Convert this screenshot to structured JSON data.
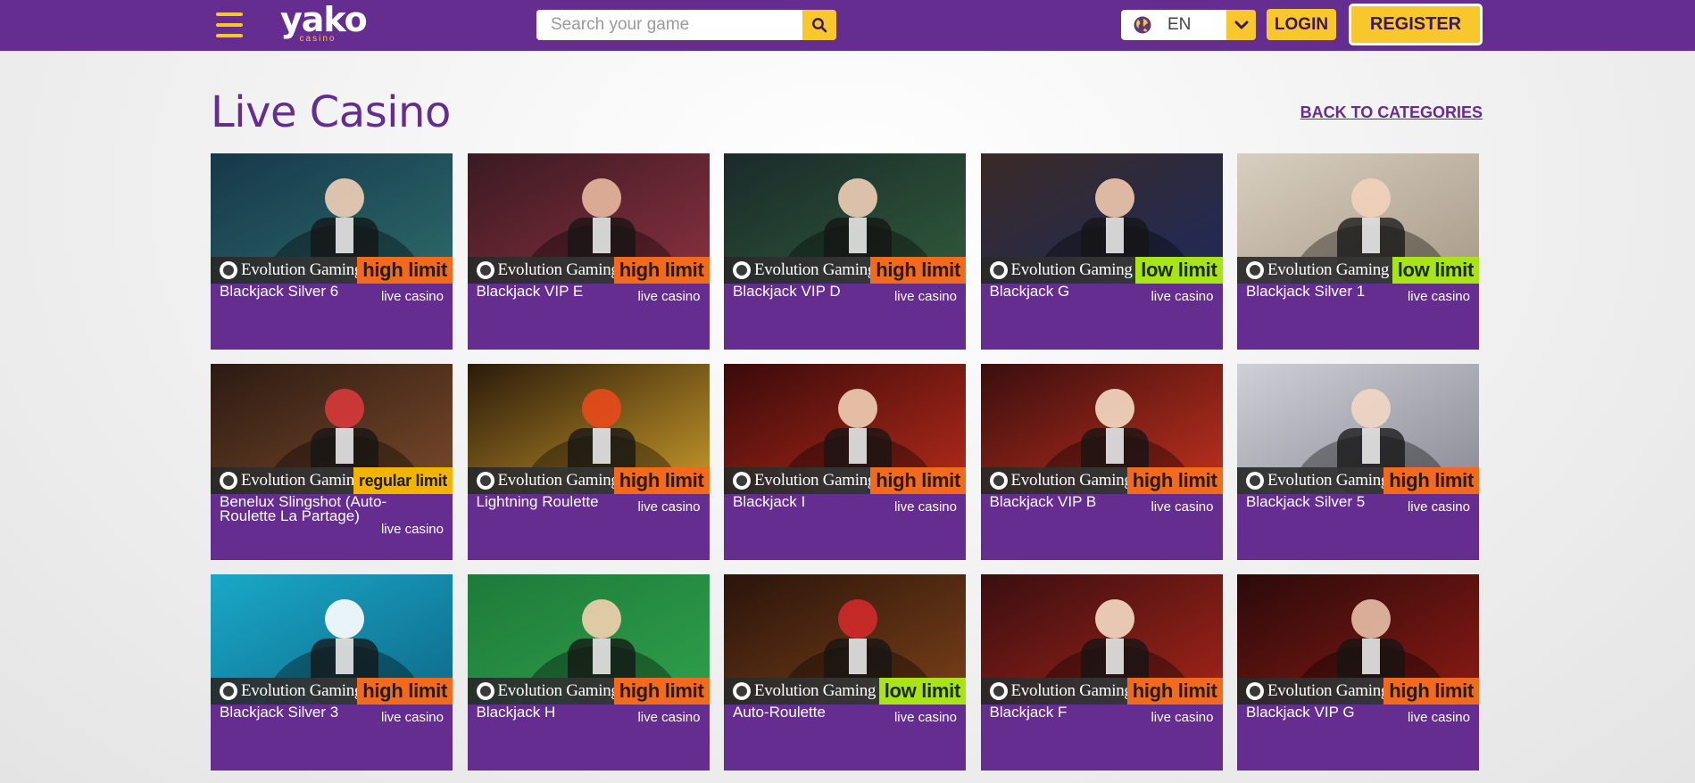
{
  "header": {
    "logo": {
      "main": "yako",
      "sub": "casino"
    },
    "search": {
      "placeholder": "Search your game"
    },
    "language": {
      "code": "EN"
    },
    "login_label": "LOGIN",
    "register_label": "REGISTER",
    "colors": {
      "brand": "#662d91",
      "accent": "#f7c72c"
    }
  },
  "page": {
    "title": "Live Casino",
    "back_link": "BACK TO CATEGORIES"
  },
  "games": [
    {
      "name": "Blackjack Silver 6",
      "category": "live casino",
      "provider": "Evolution Gaming",
      "limit": "high limit",
      "limit_type": "high"
    },
    {
      "name": "Blackjack VIP E",
      "category": "live casino",
      "provider": "Evolution Gaming",
      "limit": "high limit",
      "limit_type": "high"
    },
    {
      "name": "Blackjack VIP D",
      "category": "live casino",
      "provider": "Evolution Gaming",
      "limit": "high limit",
      "limit_type": "high"
    },
    {
      "name": "Blackjack G",
      "category": "live casino",
      "provider": "Evolution Gaming",
      "limit": "low limit",
      "limit_type": "low"
    },
    {
      "name": "Blackjack Silver 1",
      "category": "live casino",
      "provider": "Evolution Gaming",
      "limit": "low limit",
      "limit_type": "low"
    },
    {
      "name": "Benelux Slingshot (Auto-Roulette La Partage)",
      "category": "live casino",
      "provider": "Evolution Gaming",
      "limit": "regular limit",
      "limit_type": "regular"
    },
    {
      "name": "Lightning Roulette",
      "category": "live casino",
      "provider": "Evolution Gaming",
      "limit": "high limit",
      "limit_type": "high"
    },
    {
      "name": "Blackjack I",
      "category": "live casino",
      "provider": "Evolution Gaming",
      "limit": "high limit",
      "limit_type": "high"
    },
    {
      "name": "Blackjack VIP B",
      "category": "live casino",
      "provider": "Evolution Gaming",
      "limit": "high limit",
      "limit_type": "high"
    },
    {
      "name": "Blackjack Silver 5",
      "category": "live casino",
      "provider": "Evolution Gaming",
      "limit": "high limit",
      "limit_type": "high"
    },
    {
      "name": "Blackjack Silver 3",
      "category": "live casino",
      "provider": "Evolution Gaming",
      "limit": "high limit",
      "limit_type": "high"
    },
    {
      "name": "Blackjack H",
      "category": "live casino",
      "provider": "Evolution Gaming",
      "limit": "high limit",
      "limit_type": "high"
    },
    {
      "name": "Auto-Roulette",
      "category": "live casino",
      "provider": "Evolution Gaming",
      "limit": "low limit",
      "limit_type": "low"
    },
    {
      "name": "Blackjack F",
      "category": "live casino",
      "provider": "Evolution Gaming",
      "limit": "high limit",
      "limit_type": "high"
    },
    {
      "name": "Blackjack VIP G",
      "category": "live casino",
      "provider": "Evolution Gaming",
      "limit": "high limit",
      "limit_type": "high"
    }
  ]
}
